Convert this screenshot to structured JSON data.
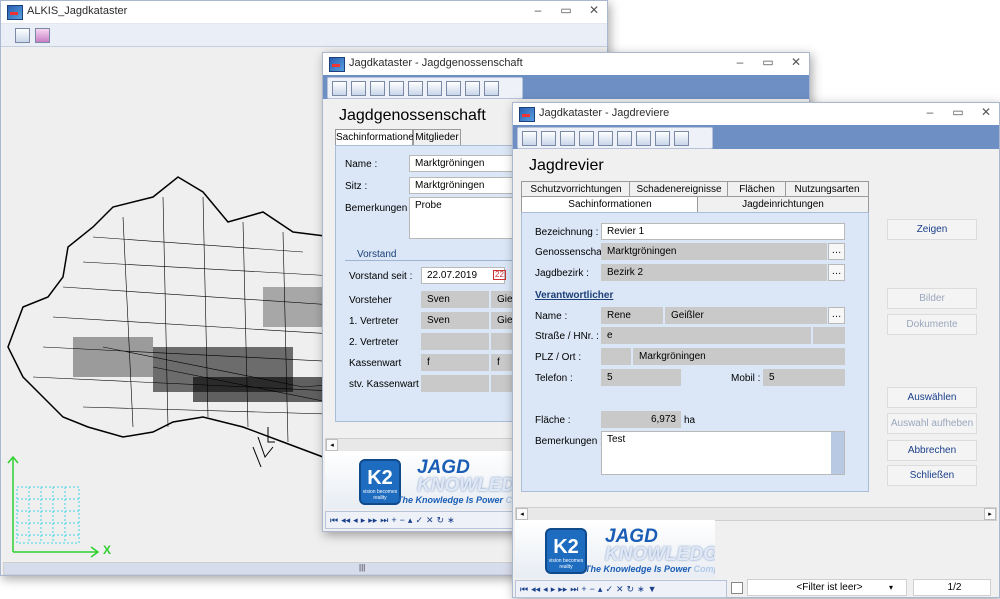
{
  "colors": {
    "accent": "#6d8fc4",
    "panel": "#dbe7f7",
    "map_grid": "#41d6e8",
    "axis_green": "#2fd12f"
  },
  "alkis": {
    "title": "ALKIS_Jagdkataster",
    "x_axis_label": "X",
    "scroll_grip": "|||"
  },
  "genossenschaft": {
    "title": "Jagdkataster - Jagdgenossenschaft",
    "heading": "Jagdgenossenschaft",
    "tabs": [
      "Sachinformationen",
      "Mitglieder"
    ],
    "name_label": "Name :",
    "name_value": "Marktgröningen",
    "sitz_label": "Sitz :",
    "sitz_value": "Marktgröningen",
    "bemerkungen_label": "Bemerkungen :",
    "bemerkungen_value": "Probe",
    "vorstand_title": "Vorstand",
    "vorstand_seit_label": "Vorstand seit :",
    "vorstand_seit_value": "22.07.2019",
    "calendar_icon_text": "22",
    "rows": [
      {
        "label": "Vorsteher",
        "v1": "Sven",
        "v2": "Giesl"
      },
      {
        "label": "1. Vertreter",
        "v1": "Sven",
        "v2": "Giesl"
      },
      {
        "label": "2. Vertreter",
        "v1": "",
        "v2": ""
      },
      {
        "label": "Kassenwart",
        "v1": "f",
        "v2": "f"
      },
      {
        "label": "stv. Kassenwart",
        "v1": "",
        "v2": ""
      }
    ]
  },
  "revier": {
    "title": "Jagdkataster - Jagdreviere",
    "heading": "Jagdrevier",
    "tabs_row1": [
      "Schutzvorrichtungen",
      "Schadenereignisse",
      "Flächen",
      "Nutzungsarten"
    ],
    "tabs_row2": [
      "Sachinformationen",
      "Jagdeinrichtungen"
    ],
    "bezeichnung_label": "Bezeichnung :",
    "bezeichnung_value": "Revier 1",
    "genossenschaft_label": "Genossenschaft :",
    "genossenschaft_value": "Marktgröningen",
    "jagdbezirk_label": "Jagdbezirk :",
    "jagdbezirk_value": "Bezirk 2",
    "verantwortlicher_title": "Verantwortlicher",
    "name_label": "Name :",
    "vorname_value": "Rene",
    "nachname_value": "Geißler",
    "strasse_label": "Straße / HNr. :",
    "strasse_value": "e",
    "plz_label": "PLZ / Ort :",
    "ort_value": "Markgröningen",
    "telefon_label": "Telefon :",
    "telefon_value": "5",
    "mobil_label": "Mobil :",
    "mobil_value": "5",
    "flaeche_label": "Fläche :",
    "flaeche_value": "6,973",
    "flaeche_unit": "ha",
    "bemerkungen_label": "Bemerkungen :",
    "bemerkungen_value": "Test",
    "buttons": {
      "zeigen": "Zeigen",
      "bilder": "Bilder",
      "dokumente": "Dokumente",
      "auswaehlen": "Auswählen",
      "auswahl_aufheben": "Auswahl aufheben",
      "abbrechen": "Abbrechen",
      "schliessen": "Schließen"
    },
    "filter_text": "<Filter ist leer>",
    "record_counter": "1/2"
  },
  "banner": {
    "jagd": "JAGD",
    "knowledge": "KNOWLEDGE",
    "slogan": "The Knowledge Is Power",
    "slogan_tail": "Company",
    "k2": "K2",
    "k2_small": "vision becomes reality"
  }
}
